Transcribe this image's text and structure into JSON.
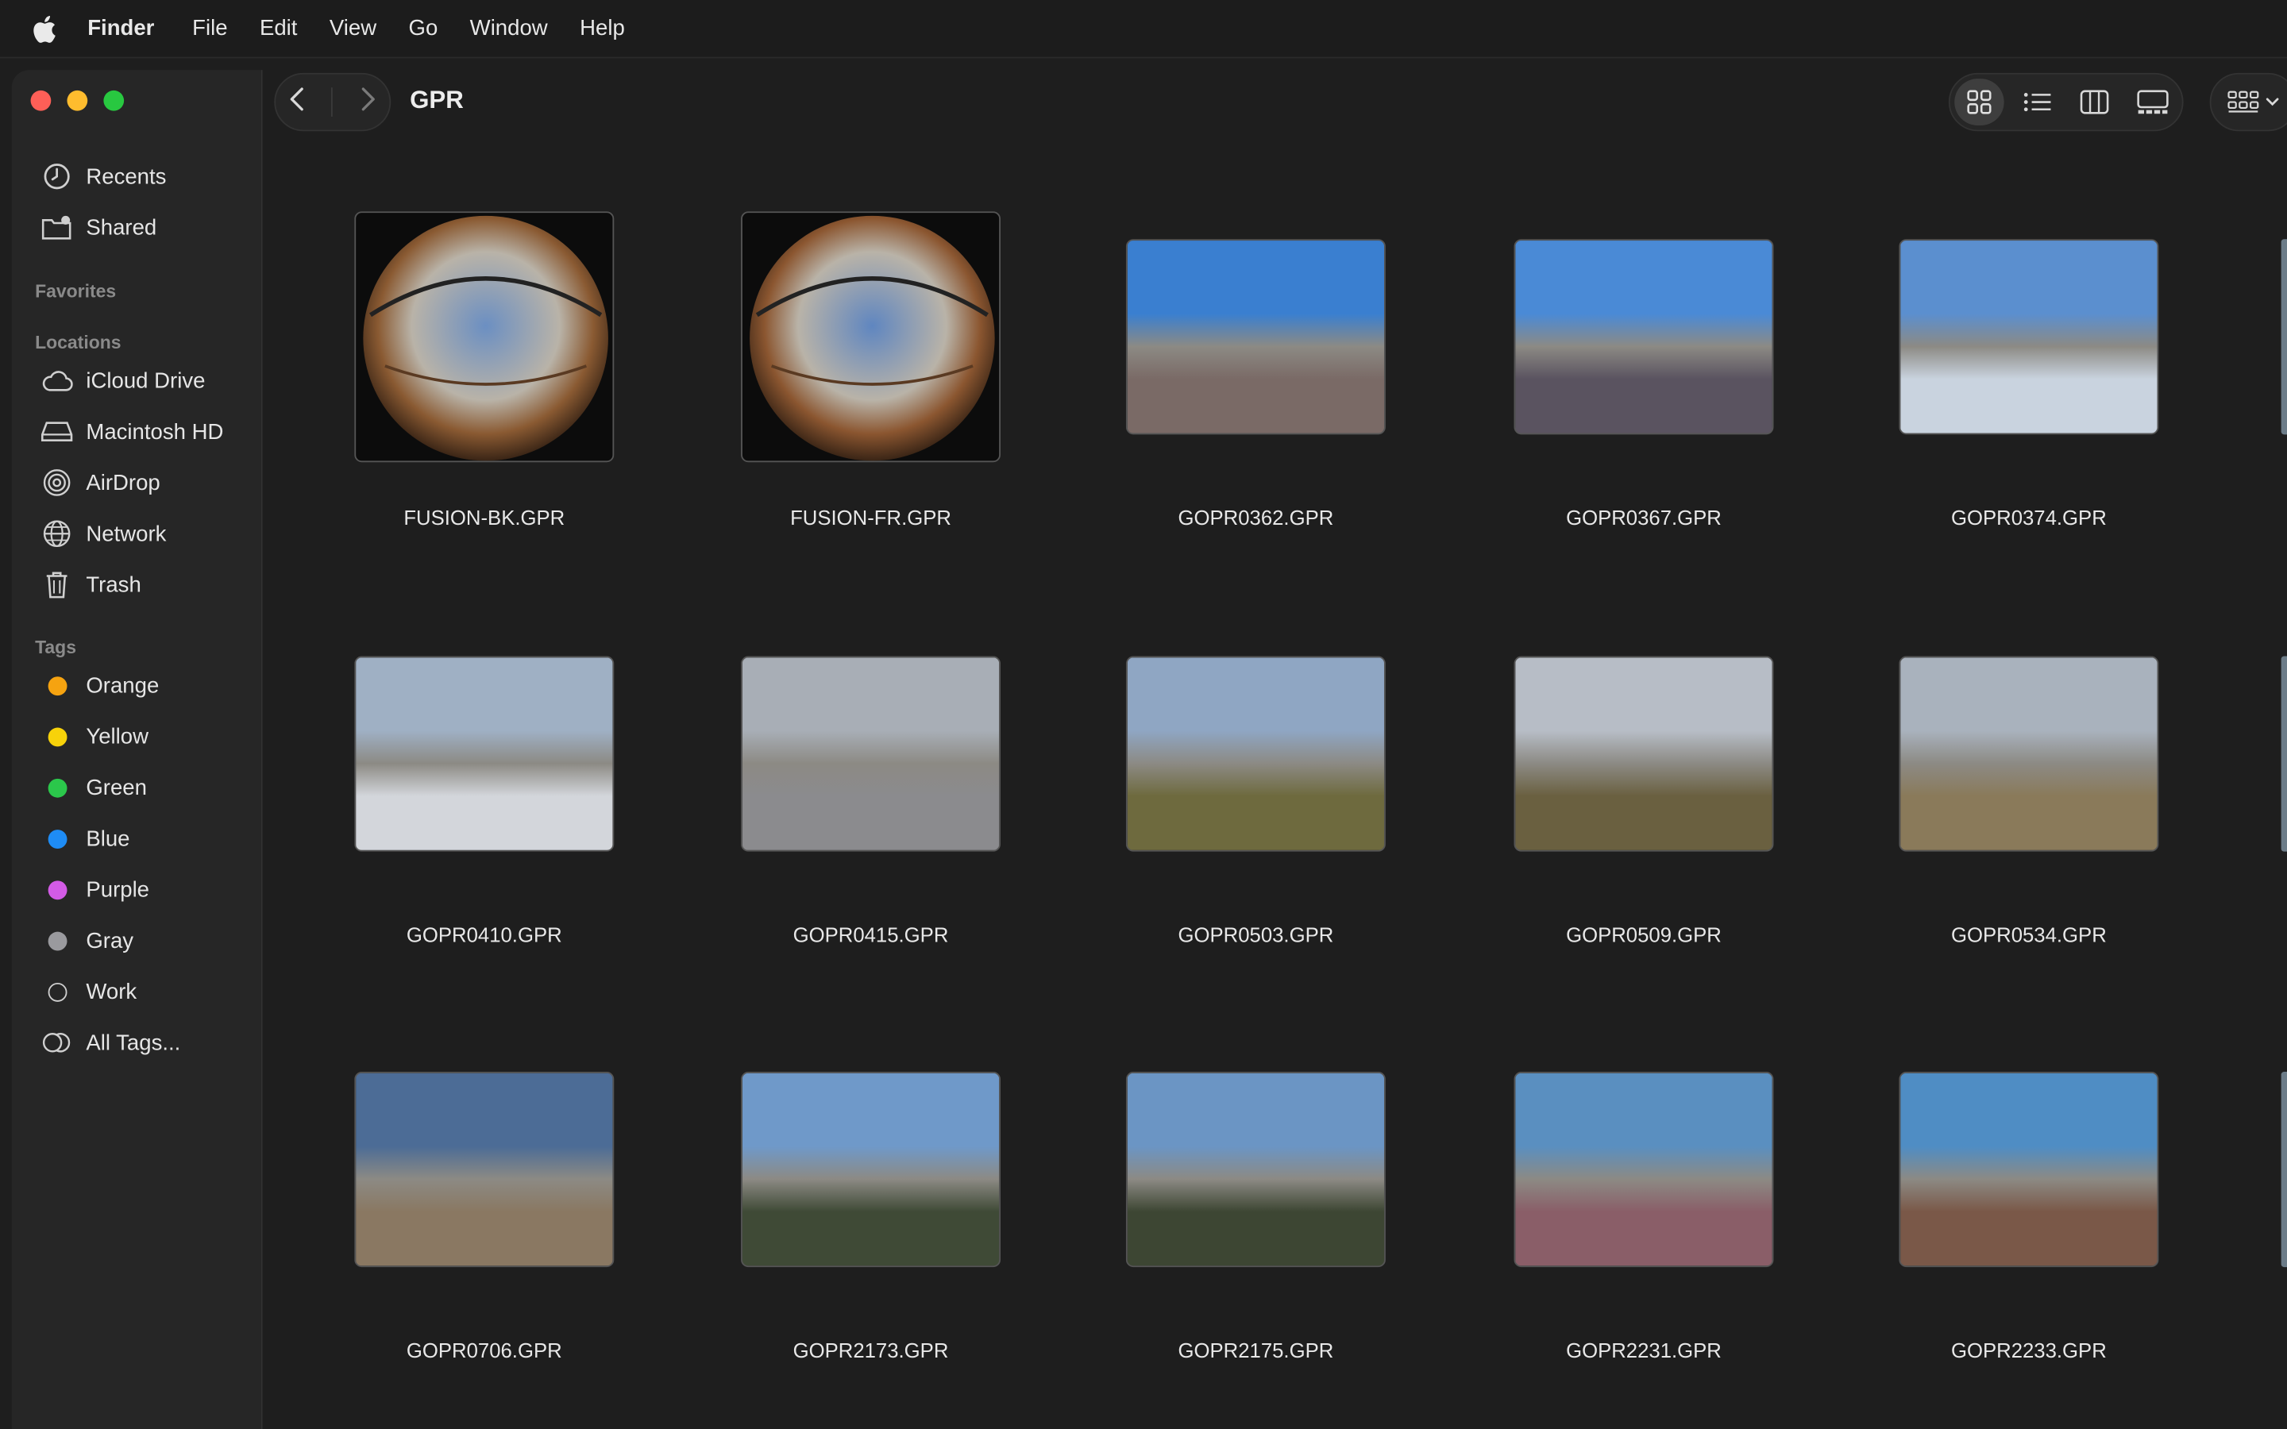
{
  "menubar": {
    "app": "Finder",
    "items": [
      "File",
      "Edit",
      "View",
      "Go",
      "Window",
      "Help"
    ]
  },
  "sidebar": {
    "top": [
      {
        "label": "Recents",
        "icon": "clock-icon"
      },
      {
        "label": "Shared",
        "icon": "shared-folder-icon"
      }
    ],
    "favorites_label": "Favorites",
    "locations_label": "Locations",
    "locations": [
      {
        "label": "iCloud Drive",
        "icon": "cloud-icon"
      },
      {
        "label": "Macintosh HD",
        "icon": "drive-icon"
      },
      {
        "label": "AirDrop",
        "icon": "airdrop-icon"
      },
      {
        "label": "Network",
        "icon": "globe-icon"
      },
      {
        "label": "Trash",
        "icon": "trash-icon"
      }
    ],
    "tags_label": "Tags",
    "tags": [
      {
        "label": "Orange",
        "color": "#f6a310"
      },
      {
        "label": "Yellow",
        "color": "#f7d20a"
      },
      {
        "label": "Green",
        "color": "#2bc74b"
      },
      {
        "label": "Blue",
        "color": "#1e8cf5"
      },
      {
        "label": "Purple",
        "color": "#d35be6"
      },
      {
        "label": "Gray",
        "color": "#9a9a9e"
      },
      {
        "label": "Work",
        "color": ""
      }
    ],
    "all_tags": "All Tags..."
  },
  "toolbar": {
    "folder_title": "GPR"
  },
  "files": [
    {
      "name": "FUSION-BK.GPR",
      "kind": "fisheye",
      "sky": "#6b8fc2",
      "ground": "#8a5a32"
    },
    {
      "name": "FUSION-FR.GPR",
      "kind": "fisheye",
      "sky": "#5f86c0",
      "ground": "#8b5630"
    },
    {
      "name": "GOPR0362.GPR",
      "kind": "wide",
      "sky": "#3a7fd0",
      "ground": "#7a6a66"
    },
    {
      "name": "GOPR0367.GPR",
      "kind": "wide",
      "sky": "#4a8ad6",
      "ground": "#5a5360"
    },
    {
      "name": "GOPR0374.GPR",
      "kind": "wide",
      "sky": "#5b8fcf",
      "ground": "#c9d3df"
    },
    {
      "name": "GOPR0410.GPR",
      "kind": "wide",
      "sky": "#9fb0c4",
      "ground": "#d3d6db"
    },
    {
      "name": "GOPR0415.GPR",
      "kind": "wide",
      "sky": "#a8aeb6",
      "ground": "#8b8b8e"
    },
    {
      "name": "GOPR0503.GPR",
      "kind": "wide",
      "sky": "#8fa6c3",
      "ground": "#6e6a3e"
    },
    {
      "name": "GOPR0509.GPR",
      "kind": "wide",
      "sky": "#b7bdc6",
      "ground": "#6a6040"
    },
    {
      "name": "GOPR0534.GPR",
      "kind": "wide",
      "sky": "#a9b2bd",
      "ground": "#8a7a5a"
    },
    {
      "name": "GOPR0706.GPR",
      "kind": "wide",
      "sky": "#4c6c96",
      "ground": "#8a7862"
    },
    {
      "name": "GOPR2173.GPR",
      "kind": "wide",
      "sky": "#6f99c9",
      "ground": "#3f4a36"
    },
    {
      "name": "GOPR2175.GPR",
      "kind": "wide",
      "sky": "#6b95c4",
      "ground": "#3d4633"
    },
    {
      "name": "GOPR2231.GPR",
      "kind": "wide",
      "sky": "#5a8fc0",
      "ground": "#8a5e68"
    },
    {
      "name": "GOPR2233.GPR",
      "kind": "wide",
      "sky": "#4f8dc4",
      "ground": "#7a5848"
    }
  ]
}
